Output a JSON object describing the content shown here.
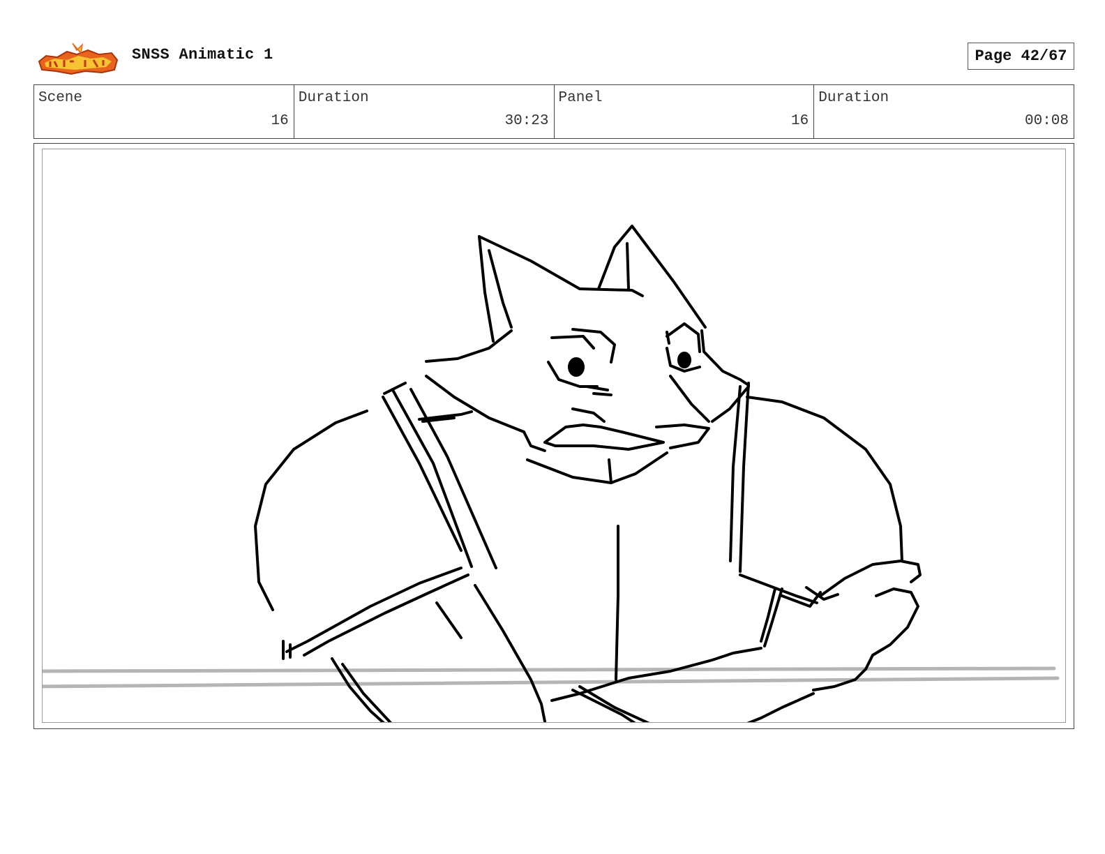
{
  "header": {
    "logo_text": "Sir Fain-So-Sleep",
    "project_title": "SNSS Animatic 1",
    "page_label": "Page 42/67"
  },
  "info": {
    "scene_label": "Scene",
    "scene_value": "16",
    "scene_duration_label": "Duration",
    "scene_duration_value": "30:23",
    "panel_label": "Panel",
    "panel_value": "16",
    "panel_duration_label": "Duration",
    "panel_duration_value": "00:08"
  },
  "panel": {
    "drawing": "pencil sketch of a cat character leaning over a table"
  },
  "colors": {
    "logo_orange": "#e8641c",
    "logo_yellow": "#f6c333",
    "table_line": "#b5b5b5",
    "ink": "#000000"
  }
}
